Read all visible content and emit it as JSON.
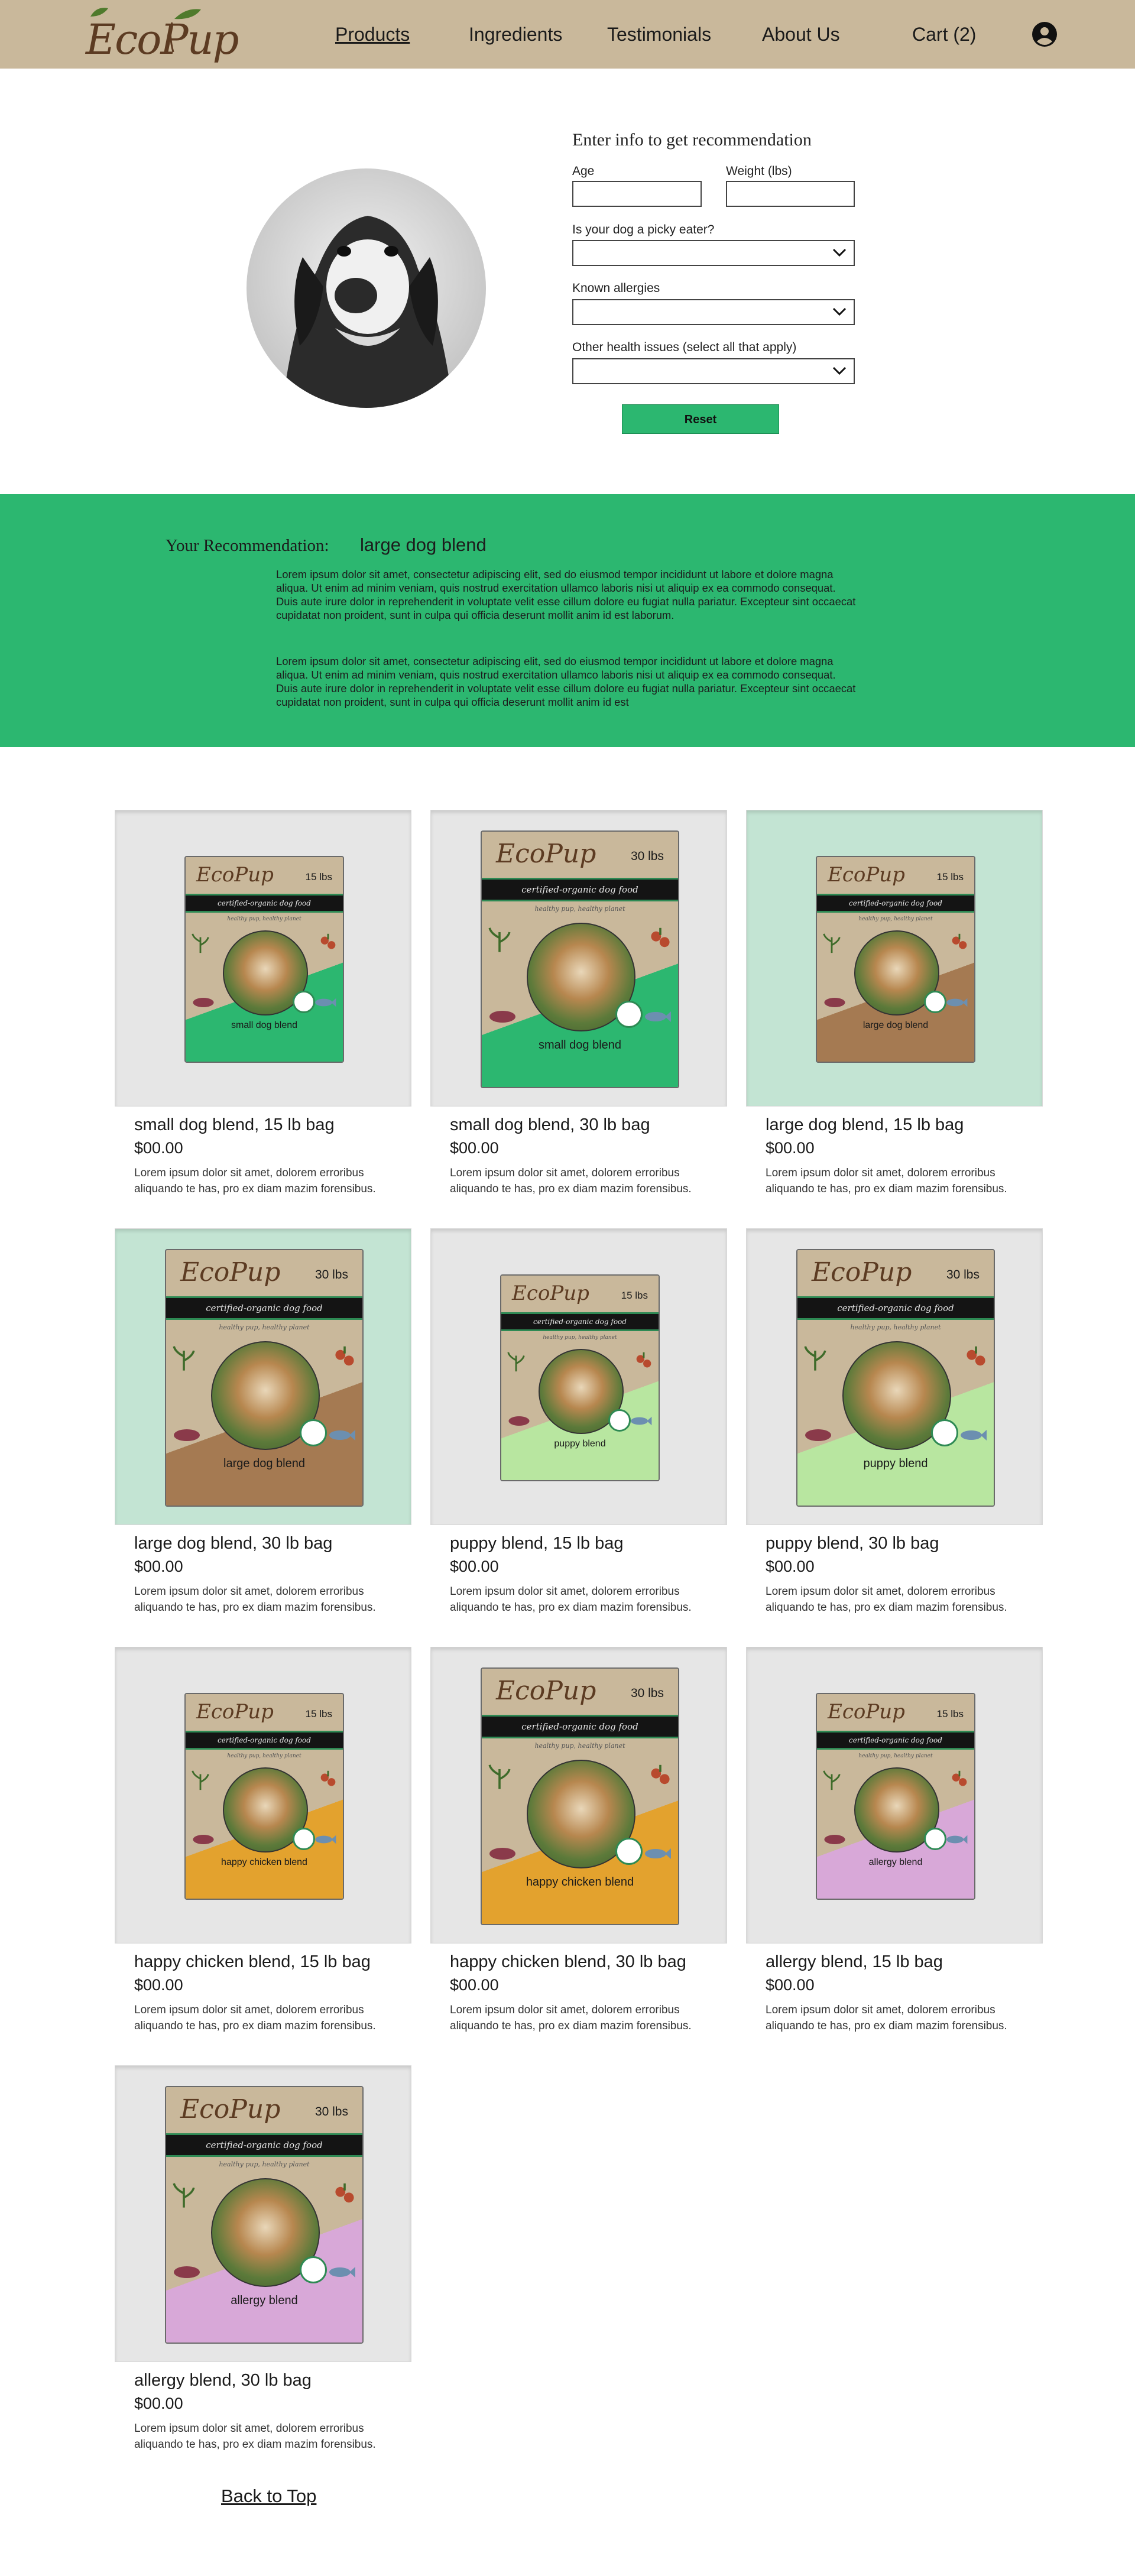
{
  "header": {
    "logo_text": "EcoPup",
    "nav": [
      "Products",
      "Ingredients",
      "Testimonials",
      "About Us",
      "Cart (2)"
    ],
    "active_nav": "Products",
    "profile_icon": "user-circle-icon",
    "bg_color": "#c9b89b"
  },
  "form": {
    "title": "Enter info to get recommendation",
    "age_label": "Age",
    "weight_label": "Weight (lbs)",
    "picky_label": "Is your dog a picky eater?",
    "allergies_label": "Known allergies",
    "health_label": "Other health issues (select all that apply)",
    "reset_label": "Reset"
  },
  "recommendation": {
    "label": "Your Recommendation:",
    "value": "large dog blend",
    "paragraphs": [
      "Lorem ipsum dolor sit amet, consectetur adipiscing elit, sed do eiusmod tempor incididunt ut labore et dolore magna aliqua. Ut enim ad minim veniam, quis nostrud exercitation ullamco laboris nisi ut aliquip ex ea commodo consequat. Duis aute irure dolor in reprehenderit in voluptate velit esse cillum dolore eu fugiat nulla pariatur. Excepteur sint occaecat cupidatat non proident, sunt in culpa qui officia deserunt mollit anim id est laborum.",
      "Lorem ipsum dolor sit amet, consectetur adipiscing elit, sed do eiusmod tempor incididunt ut labore et dolore magna aliqua. Ut enim ad minim veniam, quis nostrud exercitation ullamco laboris nisi ut aliquip ex ea commodo consequat. Duis aute irure dolor in reprehenderit in voluptate velit esse cillum dolore eu fugiat nulla pariatur. Excepteur sint occaecat cupidatat non proident, sunt in culpa qui officia deserunt mollit anim id est"
    ],
    "bg_color": "#2cb770"
  },
  "bag_common": {
    "band_text": "certified-organic dog food",
    "tagline": "healthy pup, healthy planet"
  },
  "products": [
    {
      "title": "small dog blend, 15 lb bag",
      "price": "$00.00",
      "desc": "Lorem ipsum dolor sit amet, dolorem erroribus aliquando te has, pro ex diam mazim forensibus.",
      "bag_logo": "EcoPup",
      "bag_weight": "15 lbs",
      "bag_name": "small dog blend",
      "bg": "#e6e6e6",
      "accent": "#2cb770"
    },
    {
      "title": "small dog blend, 30 lb bag",
      "price": "$00.00",
      "desc": "Lorem ipsum dolor sit amet, dolorem erroribus aliquando te has, pro ex diam mazim forensibus.",
      "bag_logo": "EcoPup",
      "bag_weight": "30 lbs",
      "bag_name": "small dog blend",
      "bg": "#e6e6e6",
      "accent": "#2cb770"
    },
    {
      "title": "large dog blend, 15 lb bag",
      "price": "$00.00",
      "desc": "Lorem ipsum dolor sit amet, dolorem erroribus aliquando te has, pro ex diam mazim forensibus.",
      "bag_logo": "EcoPup",
      "bag_weight": "15 lbs",
      "bag_name": "large dog blend",
      "bg": "#c3e4d3",
      "accent": "#a57a52"
    },
    {
      "title": "large dog blend, 30 lb bag",
      "price": "$00.00",
      "desc": "Lorem ipsum dolor sit amet, dolorem erroribus aliquando te has, pro ex diam mazim forensibus.",
      "bag_logo": "EcoPup",
      "bag_weight": "30 lbs",
      "bag_name": "large dog blend",
      "bg": "#c3e4d3",
      "accent": "#a57a52"
    },
    {
      "title": "puppy blend, 15 lb bag",
      "price": "$00.00",
      "desc": "Lorem ipsum dolor sit amet, dolorem erroribus aliquando te has, pro ex diam mazim forensibus.",
      "bag_logo": "EcoPup",
      "bag_weight": "15 lbs",
      "bag_name": "puppy blend",
      "bg": "#e6e6e6",
      "accent": "#b8e6a0"
    },
    {
      "title": "puppy blend, 30 lb bag",
      "price": "$00.00",
      "desc": "Lorem ipsum dolor sit amet, dolorem erroribus aliquando te has, pro ex diam mazim forensibus.",
      "bag_logo": "EcoPup",
      "bag_weight": "30 lbs",
      "bag_name": "puppy blend",
      "bg": "#e6e6e6",
      "accent": "#b8e6a0"
    },
    {
      "title": "happy chicken blend, 15 lb bag",
      "price": "$00.00",
      "desc": "Lorem ipsum dolor sit amet, dolorem erroribus aliquando te has, pro ex diam mazim forensibus.",
      "bag_logo": "EcoPup",
      "bag_weight": "15 lbs",
      "bag_name": "happy chicken blend",
      "bg": "#e6e6e6",
      "accent": "#e3a22e"
    },
    {
      "title": "happy chicken blend, 30 lb bag",
      "price": "$00.00",
      "desc": "Lorem ipsum dolor sit amet, dolorem erroribus aliquando te has, pro ex diam mazim forensibus.",
      "bag_logo": "EcoPup",
      "bag_weight": "30 lbs",
      "bag_name": "happy chicken blend",
      "bg": "#e6e6e6",
      "accent": "#e3a22e"
    },
    {
      "title": "allergy blend, 15 lb bag",
      "price": "$00.00",
      "desc": "Lorem ipsum dolor sit amet, dolorem erroribus aliquando te has, pro ex diam mazim forensibus.",
      "bag_logo": "EcoPup",
      "bag_weight": "15 lbs",
      "bag_name": "allergy blend",
      "bg": "#e6e6e6",
      "accent": "#d8a8d8"
    },
    {
      "title": "allergy blend, 30 lb bag",
      "price": "$00.00",
      "desc": "Lorem ipsum dolor sit amet, dolorem erroribus aliquando te has, pro ex diam mazim forensibus.",
      "bag_logo": "EcoPup",
      "bag_weight": "30 lbs",
      "bag_name": "allergy blend",
      "bg": "#e6e6e6",
      "accent": "#d8a8d8"
    }
  ],
  "back_to_top": "Back to Top"
}
